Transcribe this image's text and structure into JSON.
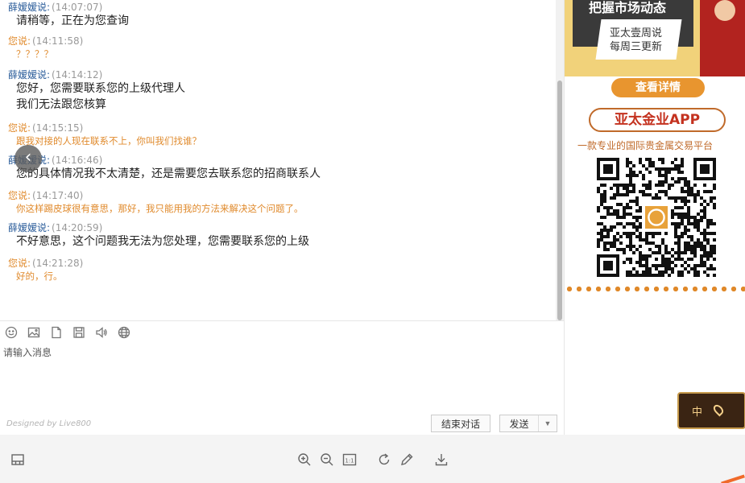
{
  "chat": {
    "messages": [
      {
        "role": "agent",
        "who": "薛嫒嫒说:",
        "time": "(14:07:07)",
        "lines": [
          "请稍等，正在为您查询"
        ]
      },
      {
        "role": "visitor",
        "who": "您说:",
        "time": "(14:11:58)",
        "lines": [
          "？？？？"
        ]
      },
      {
        "role": "agent",
        "who": "薛嫒嫒说:",
        "time": "(14:14:12)",
        "lines": [
          "您好，您需要联系您的上级代理人",
          "我们无法跟您核算"
        ]
      },
      {
        "role": "visitor",
        "who": "您说:",
        "time": "(14:15:15)",
        "lines": [
          "跟我对接的人现在联系不上，你叫我们找谁？"
        ]
      },
      {
        "role": "agent",
        "who": "薛嫒嫒说:",
        "time": "(14:16:46)",
        "lines": [
          "您的具体情况我不太清楚，还是需要您去联系您的招商联系人"
        ]
      },
      {
        "role": "visitor",
        "who": "您说:",
        "time": "(14:17:40)",
        "lines": [
          "你这样踢皮球很有意思，那好，我只能用我的方法来解决这个问题了。"
        ]
      },
      {
        "role": "agent",
        "who": "薛嫒嫒说:",
        "time": "(14:20:59)",
        "lines": [
          "不好意思，这个问题我无法为您处理，您需要联系您的上级"
        ]
      },
      {
        "role": "visitor",
        "who": "您说:",
        "time": "(14:21:28)",
        "lines": [
          "好的，行。"
        ]
      }
    ],
    "nav_back_glyph": "‹"
  },
  "composer": {
    "placeholder": "请输入消息",
    "designed_by": "Designed by Live800",
    "end_label": "结束对话",
    "send_label": "发送",
    "send_arrow": "▼",
    "tools": [
      "smile-icon",
      "image-icon",
      "file-icon",
      "save-icon",
      "volume-icon",
      "globe-icon"
    ]
  },
  "ad": {
    "banner_title": "把握市场动态",
    "banner_sub1": "亚太壹周说",
    "banner_sub2": "每周三更新",
    "detail_label": "查看详情",
    "app_title": "亚太金业APP",
    "app_subtitle": "一款专业的国际贵金属交易平台",
    "float_lang": "中",
    "colors": {
      "gold": "#f1d27a",
      "orange": "#e8952f",
      "red": "#c4321f"
    }
  },
  "viewer": {
    "tools": [
      "thumbnail-icon",
      "zoom-in-icon",
      "zoom-out-icon",
      "actual-size-icon",
      "rotate-icon",
      "edit-icon",
      "download-icon"
    ],
    "actual_size_label": "1:1"
  }
}
